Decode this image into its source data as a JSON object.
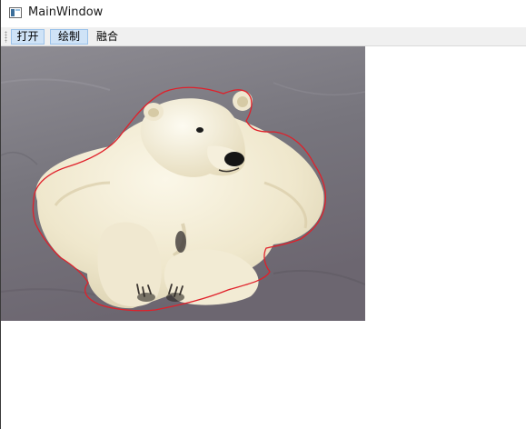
{
  "window": {
    "title": "MainWindow",
    "icon": "app-window-icon"
  },
  "toolbar": {
    "buttons": [
      {
        "label": "打开",
        "checked": true
      },
      {
        "label": "绘制",
        "checked": true
      },
      {
        "label": "融合",
        "checked": false
      }
    ]
  },
  "canvas": {
    "image_subject": "polar-bear-photo",
    "outline_color": "#e0202a"
  },
  "colors": {
    "toolbar_bg": "#f0f0f0",
    "checked_bg": "#cfe3f7",
    "checked_border": "#9ac2ea",
    "photo_ground": "#7c7a82",
    "bear_fur": "#f1ead4"
  }
}
